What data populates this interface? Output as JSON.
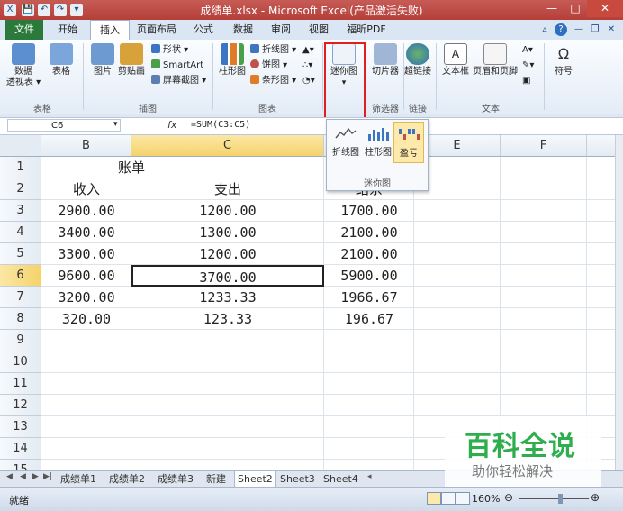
{
  "window": {
    "title": "成绩单.xlsx - Microsoft Excel(产品激活失败)",
    "controls": [
      "—",
      "□",
      "✕"
    ]
  },
  "qat": [
    "💾",
    "↶",
    "↷",
    "▾"
  ],
  "tabs": [
    "文件",
    "开始",
    "插入",
    "页面布局",
    "公式",
    "数据",
    "审阅",
    "视图",
    "福昕PDF"
  ],
  "ribbon": {
    "groups": [
      {
        "label": "表格",
        "buttons": [
          "数据\n透视表 ▾",
          "表格"
        ]
      },
      {
        "label": "插图",
        "buttons": [
          "图片",
          "剪贴画"
        ],
        "small": [
          "形状 ▾",
          "SmartArt",
          "屏幕截图 ▾"
        ]
      },
      {
        "label": "图表",
        "buttons": [
          "柱形图"
        ],
        "small": [
          "折线图 ▾",
          "饼图 ▾",
          "条形图 ▾"
        ]
      },
      {
        "label": "迷你图",
        "buttons": [
          "迷你图"
        ]
      },
      {
        "label": "筛选器",
        "buttons": [
          "切片器"
        ]
      },
      {
        "label": "链接",
        "buttons": [
          "超链接"
        ]
      },
      {
        "label": "文本",
        "buttons": [
          "文本框",
          "页眉和页脚"
        ]
      },
      {
        "label": "",
        "buttons": [
          "符号"
        ]
      }
    ]
  },
  "formula_bar": {
    "name_box": "C6",
    "fx": "fx",
    "formula": "=SUM(C3:C5)"
  },
  "sparkline_popup": {
    "items": [
      "折线图",
      "柱形图",
      "盈亏"
    ],
    "label": "迷你图"
  },
  "sheet": {
    "columns": [
      "B",
      "C",
      "D",
      "E",
      "F"
    ],
    "rows": [
      "1",
      "2",
      "3",
      "4",
      "5",
      "6",
      "7",
      "8",
      "9",
      "10",
      "11",
      "12",
      "13",
      "14",
      "15"
    ],
    "title": "账单",
    "headers": [
      "收入",
      "支出",
      "结余"
    ],
    "data": [
      [
        "2900.00",
        "1200.00",
        "1700.00"
      ],
      [
        "3400.00",
        "1300.00",
        "2100.00"
      ],
      [
        "3300.00",
        "1200.00",
        "2100.00"
      ],
      [
        "9600.00",
        "3700.00",
        "5900.00"
      ],
      [
        "3200.00",
        "1233.33",
        "1966.67"
      ],
      [
        "320.00",
        "123.33",
        "196.67"
      ]
    ],
    "selected_cell": "C6"
  },
  "sheet_tabs": [
    "成绩单1",
    "成绩单2",
    "成绩单3",
    "新建",
    "Sheet2",
    "Sheet3",
    "Sheet4"
  ],
  "active_sheet_tab": "Sheet2",
  "status": {
    "text": "就绪",
    "zoom": "160%"
  },
  "watermark": {
    "title": "百科全说",
    "subtitle": "助你轻松解决"
  }
}
